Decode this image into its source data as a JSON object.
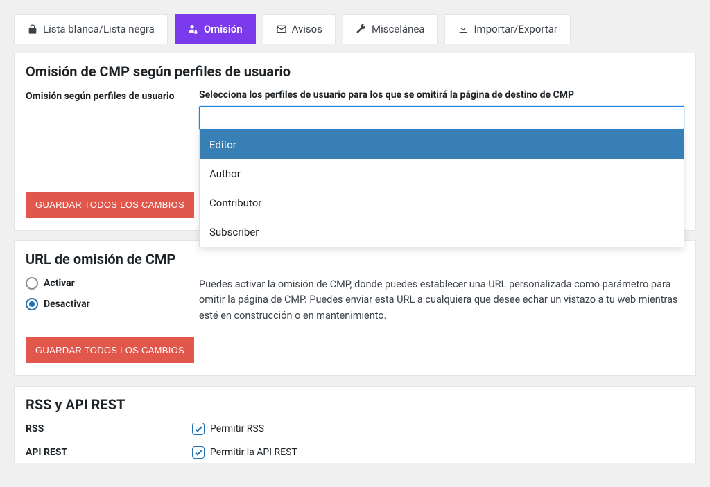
{
  "tabs": [
    {
      "label": "Lista blanca/Lista negra"
    },
    {
      "label": "Omisión"
    },
    {
      "label": "Avisos"
    },
    {
      "label": "Miscelánea"
    },
    {
      "label": "Importar/Exportar"
    }
  ],
  "section1": {
    "title": "Omisión de CMP según perfiles de usuario",
    "row_label": "Omisión según perfiles de usuario",
    "desc": "Selecciona los perfiles de usuario para los que se omitirá la página de destino de CMP",
    "options": [
      "Editor",
      "Author",
      "Contributor",
      "Subscriber"
    ],
    "save_label": "GUARDAR TODOS LOS CAMBIOS"
  },
  "section2": {
    "title": "URL de omisión de CMP",
    "activate": "Activar",
    "deactivate": "Desactivar",
    "help": "Puedes activar la omisión de CMP, donde puedes establecer una URL personalizada como parámetro para omitir la página de CMP. Puedes enviar esta URL a cualquiera que desee echar un vistazo a tu web mientras esté en construcción o en mantenimiento.",
    "save_label": "GUARDAR TODOS LOS CAMBIOS"
  },
  "section3": {
    "title": "RSS y API REST",
    "rss_label": "RSS",
    "rss_check": "Permitir RSS",
    "api_label": "API REST",
    "api_check": "Permitir la API REST"
  }
}
